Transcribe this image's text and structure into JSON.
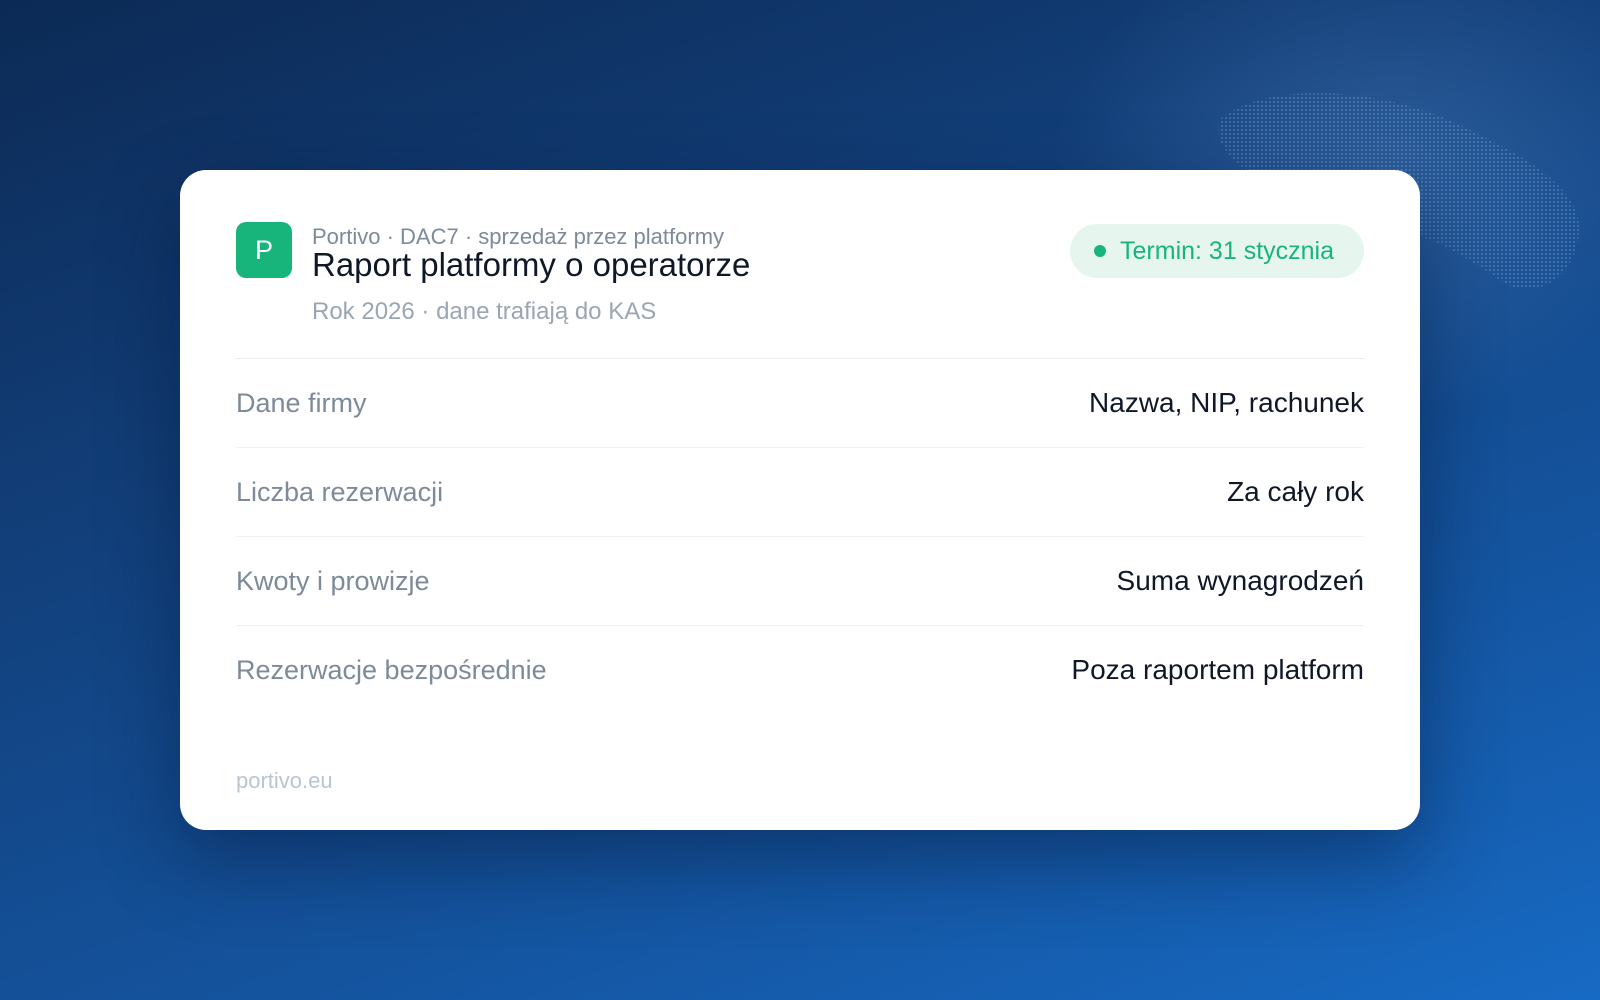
{
  "header": {
    "logo_letter": "P",
    "eyebrow": "Portivo · DAC7 · sprzedaż przez platformy",
    "title": "Raport platformy o operatorze",
    "subtitle": "Rok 2026 · dane trafiają do KAS",
    "badge_text": "Termin: 31 stycznia"
  },
  "rows": [
    {
      "label": "Dane firmy",
      "value": "Nazwa, NIP, rachunek"
    },
    {
      "label": "Liczba rezerwacji",
      "value": "Za cały rok"
    },
    {
      "label": "Kwoty i prowizje",
      "value": "Suma wynagrodzeń"
    },
    {
      "label": "Rezerwacje bezpośrednie",
      "value": "Poza raportem platform"
    }
  ],
  "footer": {
    "domain": "portivo.eu"
  },
  "colors": {
    "accent": "#17b57c",
    "badge_bg": "#e6f5ee",
    "background_dark": "#0c2a55",
    "background_light": "#176ac4"
  }
}
